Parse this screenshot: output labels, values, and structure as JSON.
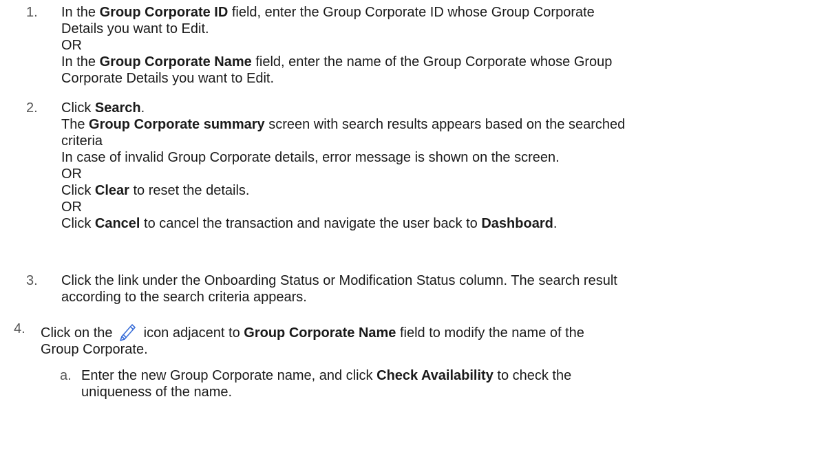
{
  "steps": [
    {
      "number": "1.",
      "lines": [
        {
          "pre": "In the ",
          "bold": "Group Corporate ID",
          "post": " field, enter the Group Corporate ID whose Group Corporate"
        },
        {
          "text": "Details you want to Edit."
        },
        {
          "text": "OR"
        },
        {
          "pre": "In the ",
          "bold": "Group Corporate Name",
          "post": " field, enter the name of the Group Corporate whose Group"
        },
        {
          "text": "Corporate Details you want to Edit."
        }
      ]
    },
    {
      "number": "2.",
      "lines": [
        {
          "pre": "Click ",
          "bold": "Search",
          "post": "."
        },
        {
          "pre": "The ",
          "bold": "Group Corporate summary",
          "post": " screen with search results appears based on the searched"
        },
        {
          "text": "criteria"
        },
        {
          "text": "In case of invalid Group Corporate details, error message is shown on the screen."
        },
        {
          "text": "OR"
        },
        {
          "pre": "Click ",
          "bold": "Clear",
          "post": " to reset the details."
        },
        {
          "text": "OR"
        },
        {
          "pre": "Click ",
          "bold": "Cancel",
          "post": " to cancel the transaction and navigate the user back to ",
          "bold2": "Dashboard",
          "post2": "."
        }
      ]
    },
    {
      "number": "3.",
      "lines": [
        {
          "text": "Click the link under the Onboarding Status or Modification Status column. The search result"
        },
        {
          "text": "according to the search criteria appears."
        }
      ]
    },
    {
      "number": "4.",
      "lines": [
        {
          "pre": "Click on the ",
          "icon": "pencil-icon",
          "mid": " icon adjacent to ",
          "bold": "Group Corporate Name",
          "post": " field to modify the name of the"
        },
        {
          "text": "Group Corporate."
        }
      ]
    },
    {
      "number": "a.",
      "lines": [
        {
          "pre": "Enter the new Group Corporate name, and click ",
          "bold": "Check Availability",
          "post": " to check the"
        },
        {
          "text": "uniqueness of the name."
        }
      ]
    }
  ],
  "colors": {
    "text": "#1a1a1a",
    "number": "#555555",
    "icon_stroke": "#3b6fd8"
  }
}
